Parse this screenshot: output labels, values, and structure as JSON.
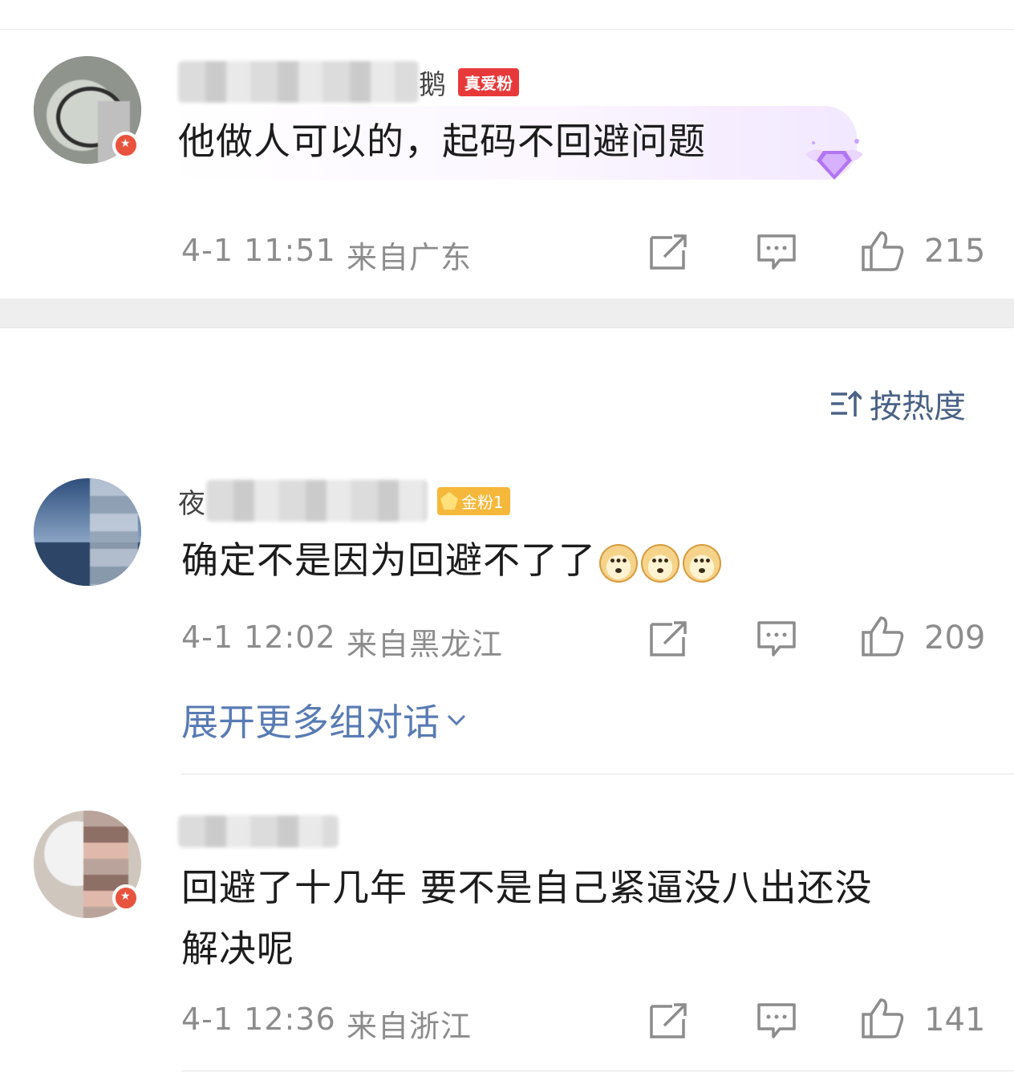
{
  "sort": {
    "label": "按热度",
    "icon": "sort-icon"
  },
  "top_comment": {
    "username_suffix": "鹅",
    "badge": "真爱粉",
    "text": "他做人可以的，起码不回避问题",
    "time": "4-1 11:51",
    "location": "来自广东",
    "likes": "215"
  },
  "comments": [
    {
      "username_prefix": "夜",
      "badge": "金粉1",
      "text": "确定不是因为回避不了了",
      "emoji_count": 3,
      "emoji": "doge-emoji",
      "time": "4-1 12:02",
      "location": "来自黑龙江",
      "likes": "209"
    },
    {
      "text_line1": "回避了十几年 要不是自己紧逼没八出还没",
      "text_line2": "解决呢",
      "time": "4-1 12:36",
      "location": "来自浙江",
      "likes": "141"
    }
  ],
  "expand_link": "展开更多组对话",
  "colors": {
    "accent": "#587bb3",
    "meta": "#8c8c8c",
    "badge_red": "#e8393a",
    "badge_gold": "#f5b83a"
  }
}
